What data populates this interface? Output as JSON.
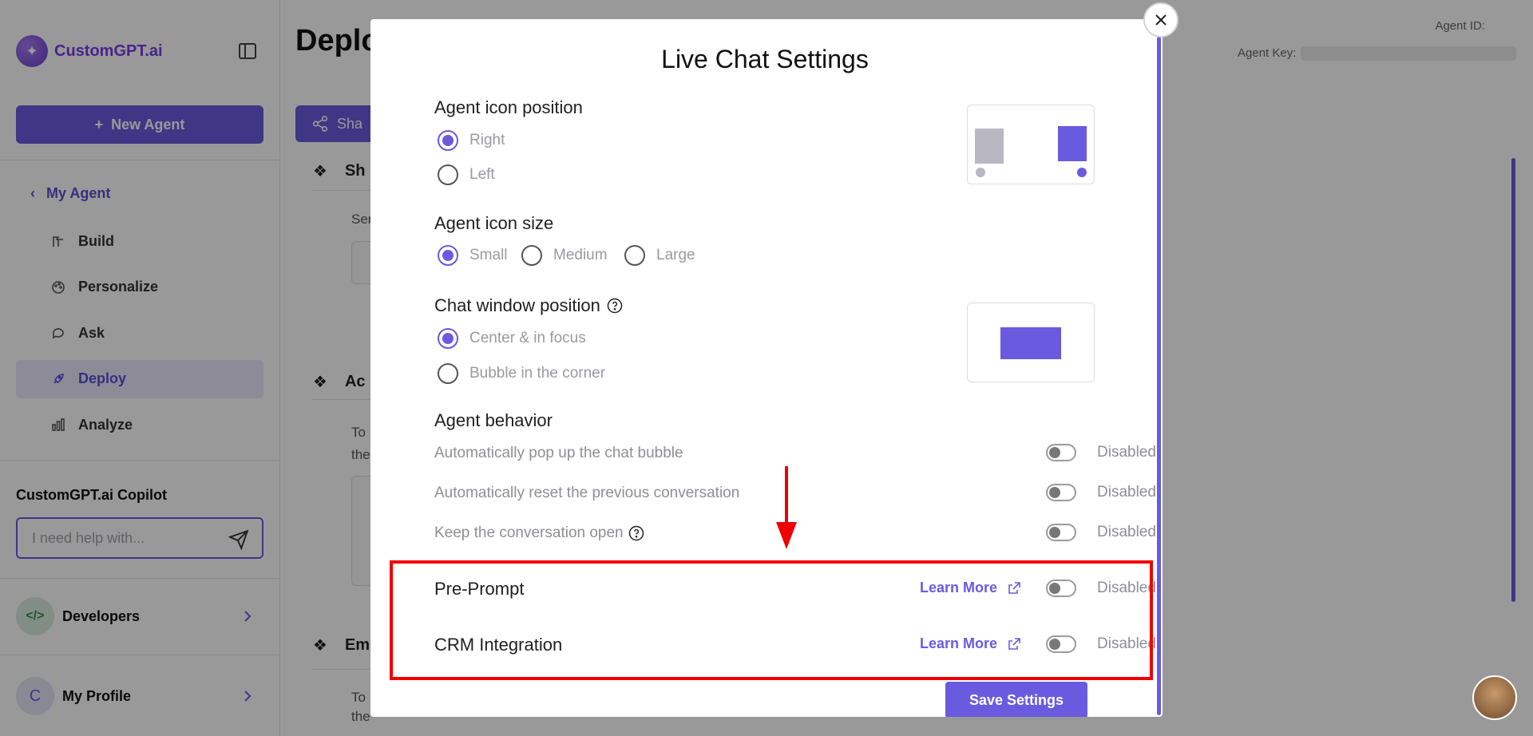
{
  "sidebar": {
    "brand": "CustomGPT.ai",
    "new_agent_label": "New Agent",
    "my_agent_label": "My Agent",
    "nav_items": [
      {
        "label": "Build",
        "icon": "build-icon"
      },
      {
        "label": "Personalize",
        "icon": "palette-icon"
      },
      {
        "label": "Ask",
        "icon": "chat-icon"
      },
      {
        "label": "Deploy",
        "icon": "rocket-icon",
        "active": true
      },
      {
        "label": "Analyze",
        "icon": "bar-chart-icon"
      }
    ],
    "copilot_title": "CustomGPT.ai Copilot",
    "copilot_placeholder": "I need help with...",
    "developers_label": "Developers",
    "profile_label": "My Profile",
    "profile_initial": "C"
  },
  "background": {
    "page_title": "Deplo",
    "agent_id_label": "Agent ID:",
    "agent_key_label": "Agent Key:",
    "share_label": "Sha",
    "section1": "Sh",
    "section1_text": "Ser",
    "section2": "Ac",
    "section2_text_a": "To",
    "section2_text_b": "the",
    "section3": "Em",
    "section3_text_a": "To",
    "section3_text_b": "the"
  },
  "modal": {
    "title": "Live Chat Settings",
    "icon_position": {
      "heading": "Agent icon position",
      "options": [
        "Right",
        "Left"
      ],
      "selected": "Right"
    },
    "icon_size": {
      "heading": "Agent icon size",
      "options": [
        "Small",
        "Medium",
        "Large"
      ],
      "selected": "Small"
    },
    "window_position": {
      "heading": "Chat window position",
      "options": [
        "Center & in focus",
        "Bubble in the corner"
      ],
      "selected": "Center & in focus"
    },
    "behavior": {
      "heading": "Agent behavior",
      "rows": [
        {
          "label": "Automatically pop up the chat bubble",
          "state": "Disabled"
        },
        {
          "label": "Automatically reset the previous conversation",
          "state": "Disabled"
        },
        {
          "label": "Keep the conversation open",
          "state": "Disabled"
        }
      ]
    },
    "pre_prompt": {
      "label": "Pre-Prompt",
      "learn_more": "Learn More",
      "state": "Disabled"
    },
    "crm": {
      "label": "CRM Integration",
      "learn_more": "Learn More",
      "state": "Disabled"
    },
    "save_label": "Save Settings"
  },
  "colors": {
    "accent": "#6a5ae0",
    "annotation": "#ef0000"
  }
}
